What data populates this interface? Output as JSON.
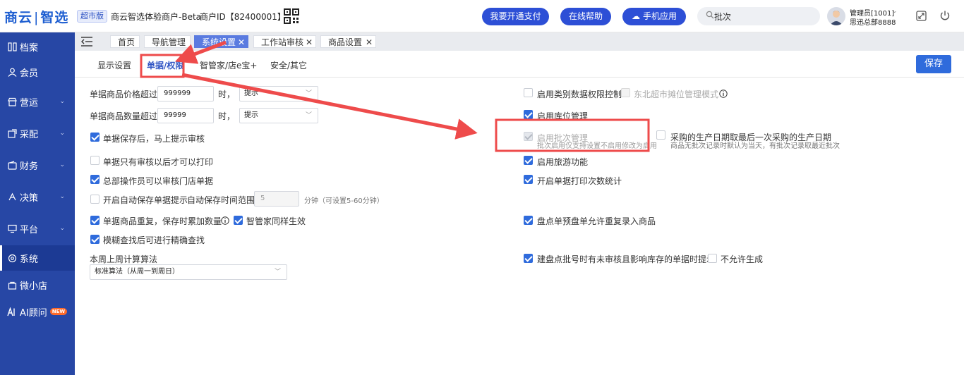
{
  "header": {
    "logo_left": "商云",
    "logo_right": "智选",
    "edition": "超市版",
    "merchant_name": "商云智选体验商户-Beta",
    "merchant_id": "商户ID【82400001】",
    "btn_pay": "我要开通支付",
    "btn_help": "在线帮助",
    "btn_mobile": "手机应用",
    "search_value": "批次",
    "user_name": "管理员[1001]",
    "user_org": "思迅总部8888"
  },
  "sidebar": {
    "items": [
      {
        "label": "档案"
      },
      {
        "label": "会员"
      },
      {
        "label": "营运"
      },
      {
        "label": "采配"
      },
      {
        "label": "财务"
      },
      {
        "label": "决策"
      },
      {
        "label": "平台"
      },
      {
        "label": "系统"
      },
      {
        "label": "微小店"
      },
      {
        "label": "AI顾问",
        "badge": "NEW"
      }
    ]
  },
  "tabs": [
    {
      "label": "首页"
    },
    {
      "label": "导航管理"
    },
    {
      "label": "系统设置"
    },
    {
      "label": "工作站审核"
    },
    {
      "label": "商品设置"
    }
  ],
  "tab_close": "✕",
  "subtabs": [
    {
      "label": "显示设置"
    },
    {
      "label": "单据/权限"
    },
    {
      "label": "智管家/店e宝+"
    },
    {
      "label": "安全/其它"
    }
  ],
  "save_label": "保存",
  "form": {
    "price_label": "单据商品价格超过",
    "price_value": "999999",
    "price_unit": "时，",
    "price_action": "提示",
    "qty_label": "单据商品数量超过",
    "qty_value": "99999",
    "qty_unit": "时，",
    "qty_action": "提示",
    "save_review": "单据保存后，马上提示审核",
    "print_after_review": "单据只有审核以后才可以打印",
    "hq_review_store": "总部操作员可以审核门店单据",
    "autosave": "开启自动保存单据提示",
    "autosave_range_label": "自动保存时间范围",
    "autosave_value": "5",
    "autosave_hint": "分钟（可设置5-60分钟）",
    "dup_accumulate": "单据商品重复，保存时累加数量",
    "smart_same": "智管家同样生效",
    "fuzzy_exact": "模糊查找后可进行精确查找",
    "week_algo_label": "本周上周计算算法",
    "week_algo_value": "标准算法（从周一到周日）",
    "cat_permission": "启用类别数据权限控制",
    "northeast_mode": "东北超市摊位管理模式",
    "location_mgmt": "启用库位管理",
    "batch_mgmt": "启用批次管理",
    "batch_hint": "批次启用仅支持设置不启用修改为启用",
    "purchase_date": "采购的生产日期取最后一次采购的生产日期",
    "purchase_hint": "商品无批次记录时默认为当天，有批次记录取最近批次",
    "travel": "启用旅游功能",
    "print_count": "开启单据打印次数统计",
    "inventory_dup": "盘点单预盘单允许重复录入商品",
    "batch_inventory": "建盘点批号时有未审核且影响库存的单据时提示",
    "no_generate": "不允许生成"
  },
  "colors": {
    "sidebar": "#2747a5",
    "primary": "#2f6bdc",
    "header_button": "#2d4fd6",
    "annotation_red": "#ee4b4b"
  }
}
